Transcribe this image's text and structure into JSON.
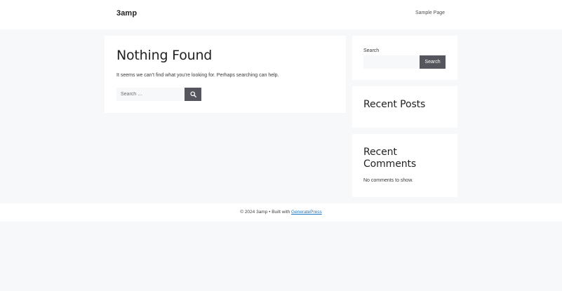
{
  "header": {
    "site_title": "3amp",
    "nav": [
      {
        "label": "Sample Page"
      }
    ]
  },
  "main": {
    "title": "Nothing Found",
    "message": "It seems we can’t find what you’re looking for. Perhaps searching can help.",
    "search": {
      "placeholder": "Search …",
      "value": "",
      "button_icon": "search-icon"
    }
  },
  "sidebar": {
    "search_widget": {
      "label": "Search",
      "value": "",
      "button_label": "Search"
    },
    "recent_posts": {
      "title": "Recent Posts"
    },
    "recent_comments": {
      "title": "Recent Comments",
      "empty_text": "No comments to show."
    }
  },
  "footer": {
    "copyright": "© 2024 3amp • Built with ",
    "link_label": "GeneratePress"
  },
  "colors": {
    "page_bg": "#f7f8f9",
    "button_bg": "#55555e",
    "link": "#1e73be"
  }
}
